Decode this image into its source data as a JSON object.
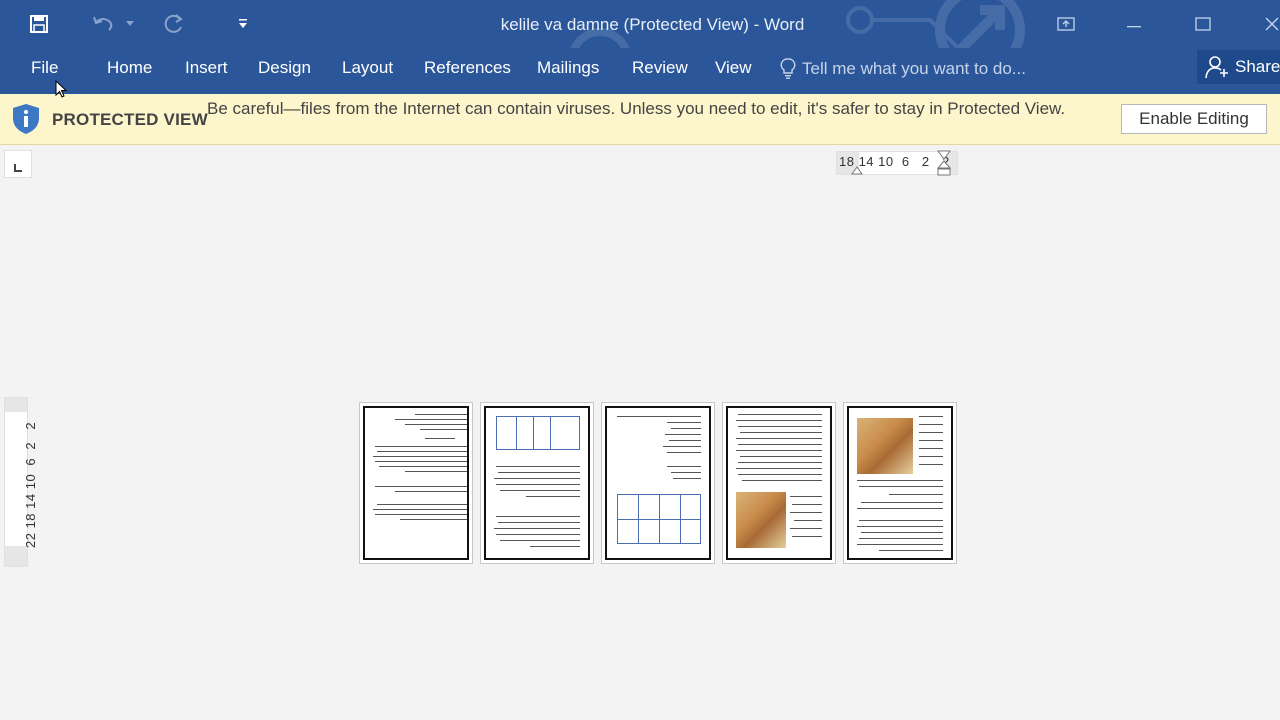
{
  "window": {
    "title": "kelile va damne (Protected View) - Word"
  },
  "quick_access": {
    "save_icon": "save-icon",
    "undo_icon": "undo-icon",
    "redo_icon": "redo-icon",
    "customize_icon": "customize-quick-access-icon"
  },
  "ribbon": {
    "tabs": [
      "File",
      "Home",
      "Insert",
      "Design",
      "Layout",
      "References",
      "Mailings",
      "Review",
      "View"
    ],
    "tell_me": "Tell me what you want to do...",
    "share": "Share"
  },
  "protected_view": {
    "title": "PROTECTED VIEW",
    "message": "Be careful—files from the Internet can contain viruses. Unless you need to edit, it's safer to stay in Protected View.",
    "enable_button": "Enable Editing"
  },
  "rulers": {
    "horizontal": "18 14 10  6   2   2",
    "vertical": "22 18 14 10  6  2   2"
  },
  "colors": {
    "ribbon": "#2b579a",
    "protected_bar": "#fdf6cc"
  }
}
